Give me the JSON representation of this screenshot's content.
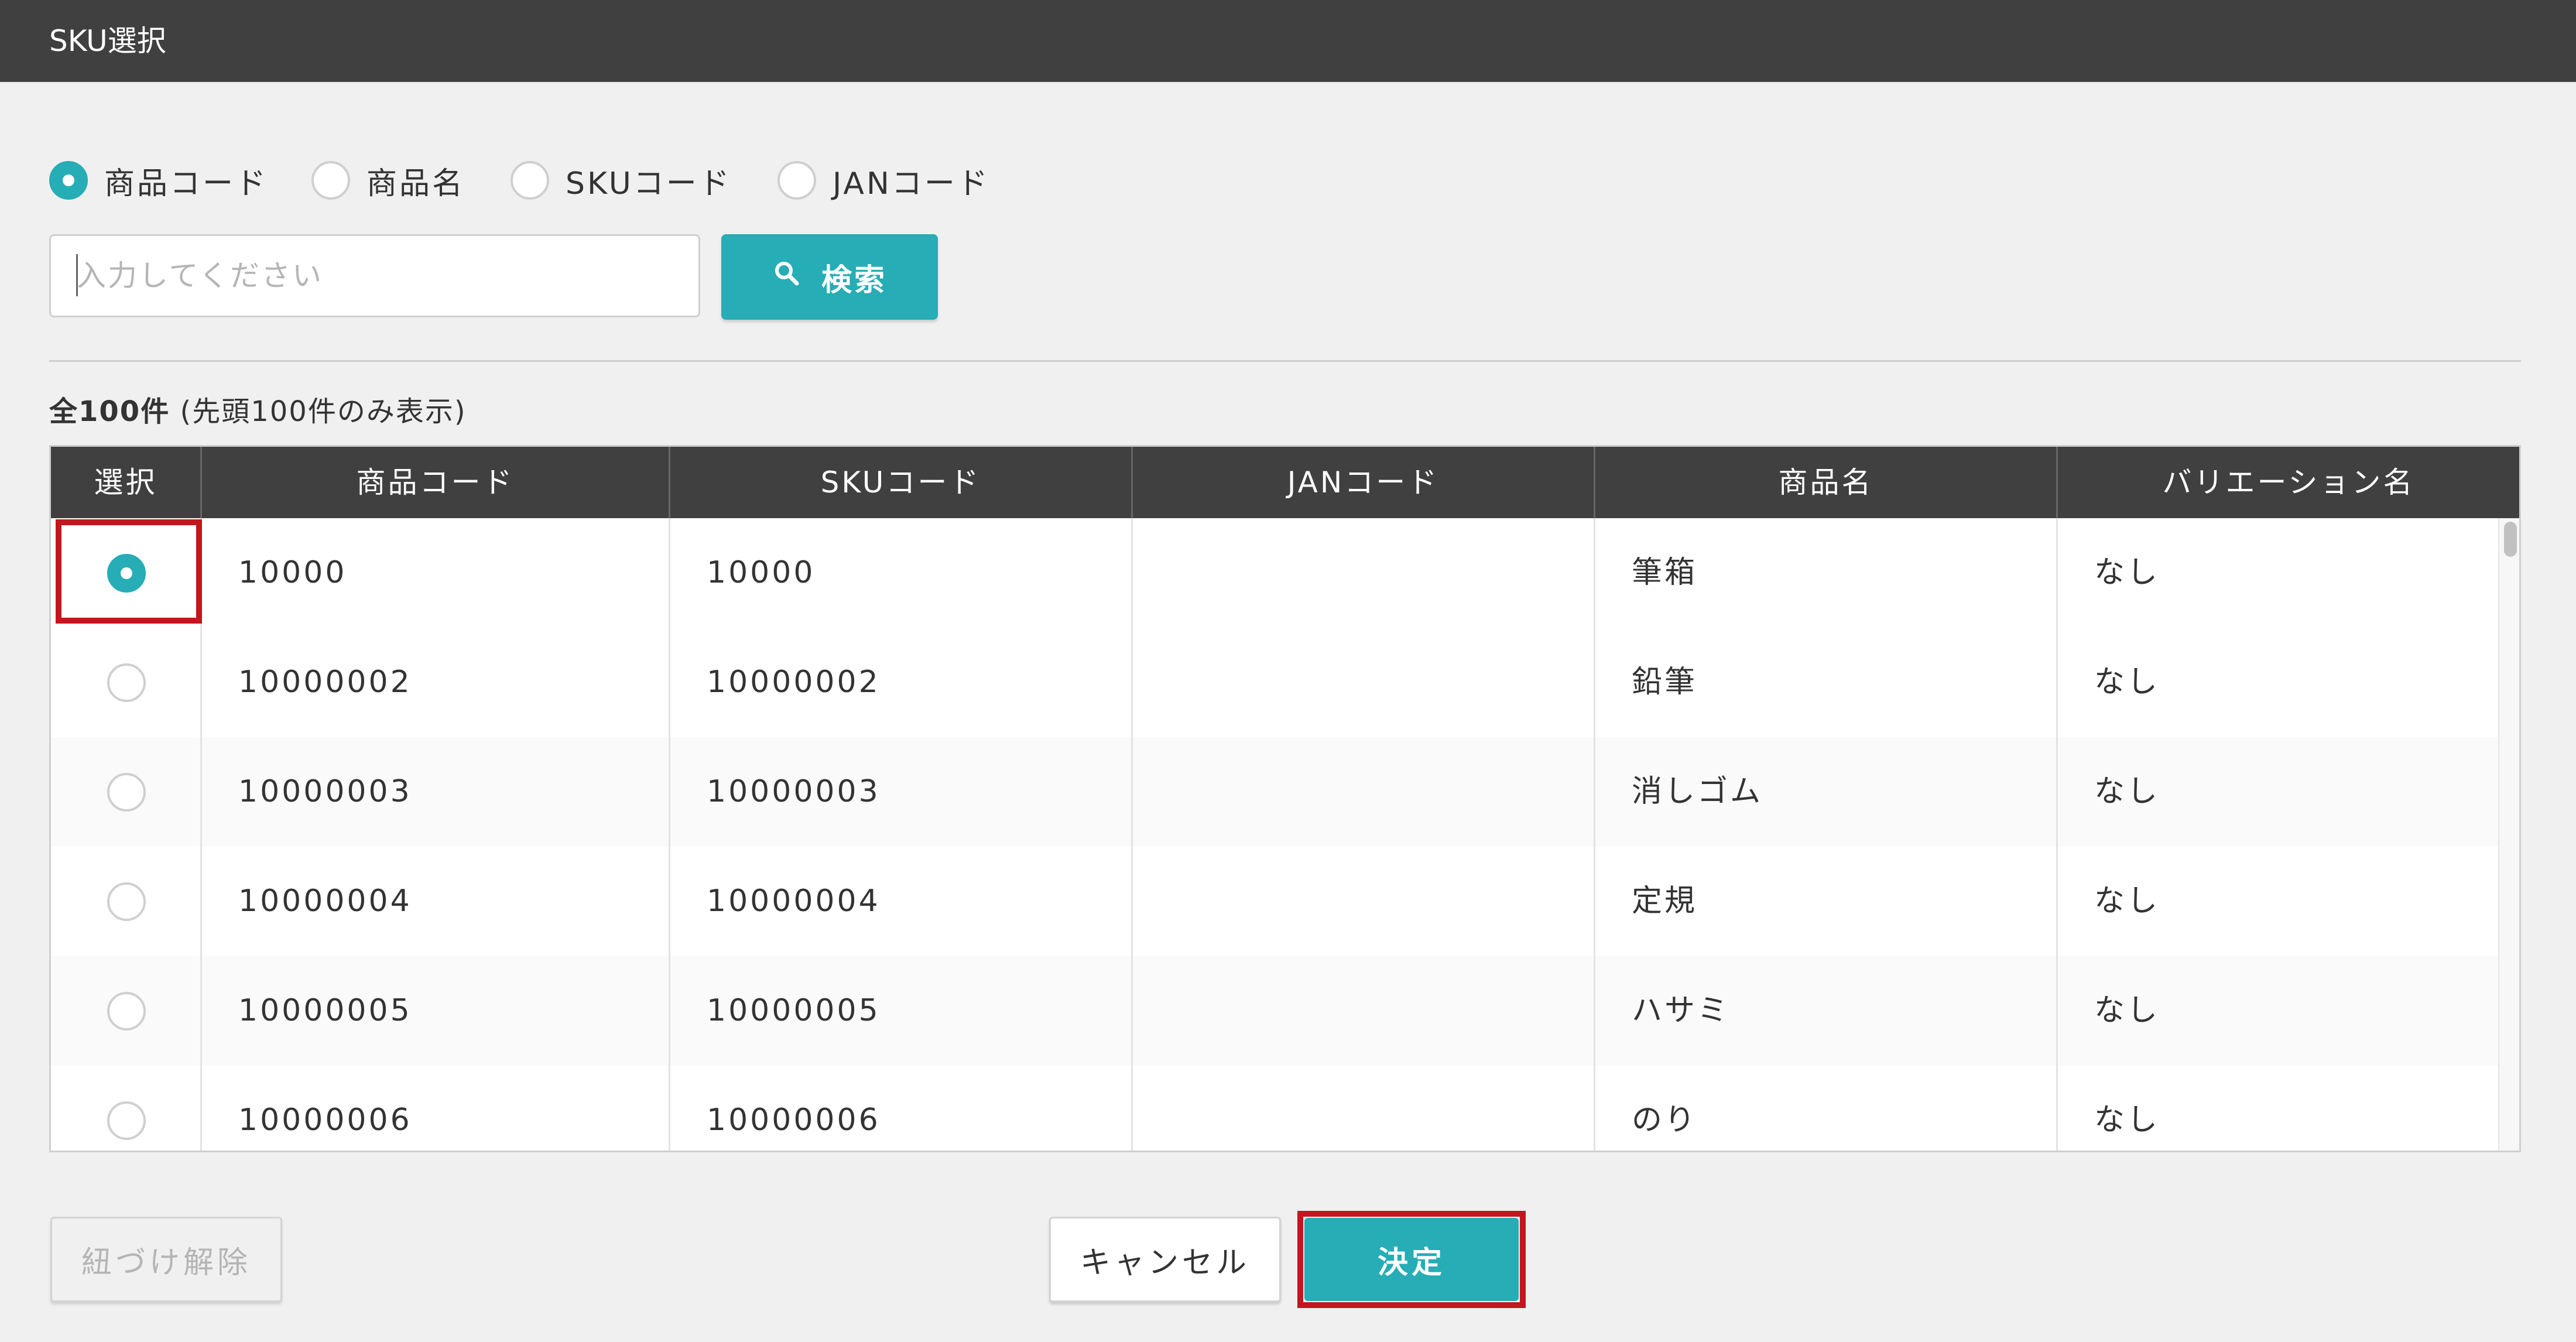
{
  "title": "SKU選択",
  "search_types": [
    {
      "label": "商品コード",
      "checked": true
    },
    {
      "label": "商品名",
      "checked": false
    },
    {
      "label": "SKUコード",
      "checked": false
    },
    {
      "label": "JANコード",
      "checked": false
    }
  ],
  "search": {
    "placeholder": "入力してください",
    "button_label": "検索",
    "button_icon": "search-icon"
  },
  "result_count": {
    "total": "全100件",
    "note": "(先頭100件のみ表示)"
  },
  "table": {
    "columns": [
      "選択",
      "商品コード",
      "SKUコード",
      "JANコード",
      "商品名",
      "バリエーション名"
    ],
    "rows": [
      {
        "selected": true,
        "product_code": "10000",
        "sku_code": "10000",
        "jan_code": "",
        "product_name": "筆箱",
        "variation": "なし"
      },
      {
        "selected": false,
        "product_code": "10000002",
        "sku_code": "10000002",
        "jan_code": "",
        "product_name": "鉛筆",
        "variation": "なし"
      },
      {
        "selected": false,
        "product_code": "10000003",
        "sku_code": "10000003",
        "jan_code": "",
        "product_name": "消しゴム",
        "variation": "なし"
      },
      {
        "selected": false,
        "product_code": "10000004",
        "sku_code": "10000004",
        "jan_code": "",
        "product_name": "定規",
        "variation": "なし"
      },
      {
        "selected": false,
        "product_code": "10000005",
        "sku_code": "10000005",
        "jan_code": "",
        "product_name": "ハサミ",
        "variation": "なし"
      },
      {
        "selected": false,
        "product_code": "10000006",
        "sku_code": "10000006",
        "jan_code": "",
        "product_name": "のり",
        "variation": "なし"
      }
    ]
  },
  "footer": {
    "unlink_label": "紐づけ解除",
    "cancel_label": "キャンセル",
    "confirm_label": "決定"
  },
  "colors": {
    "accent": "#26adb5",
    "header_bg": "#404040",
    "highlight": "#c2171e"
  }
}
